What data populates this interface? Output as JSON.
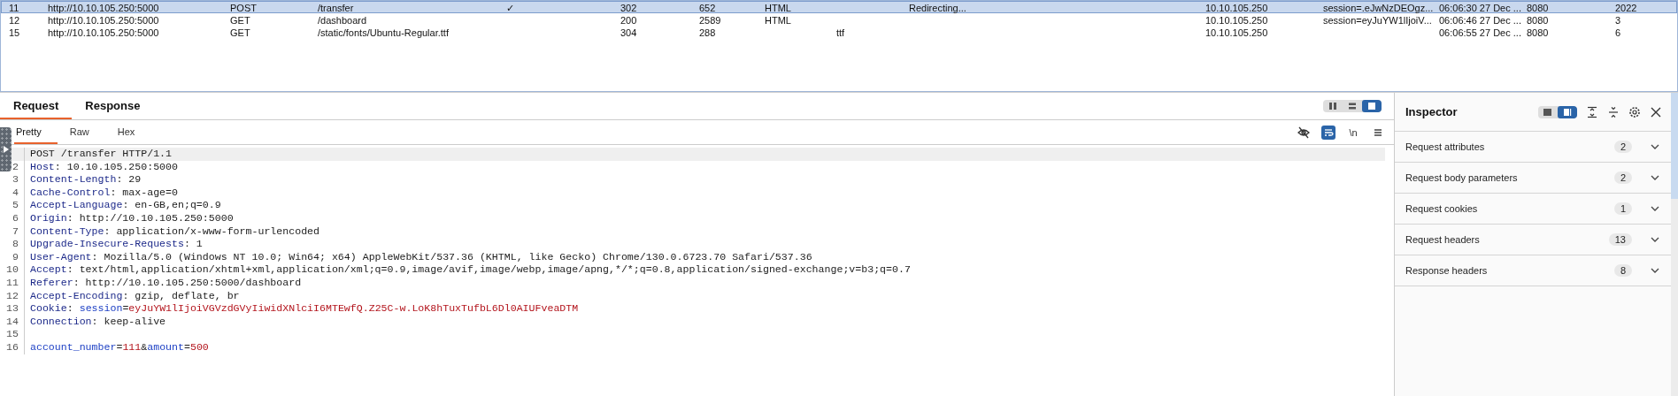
{
  "history": {
    "rows": [
      {
        "selected": true,
        "column_1": "11",
        "column_2": "http://10.10.105.250:5000",
        "column_3": "POST",
        "column_4": "/transfer",
        "column_5": "✓",
        "column_6": "302",
        "column_7": "652",
        "column_8": "HTML",
        "column_10": "Redirecting...",
        "column_11": "10.10.105.250",
        "column_12": "session=.eJwNzDEOgz...",
        "column_13": "06:06:30 27 Dec ...",
        "column_14": "8080",
        "column_15": "2022"
      },
      {
        "selected": false,
        "column_1": "12",
        "column_2": "http://10.10.105.250:5000",
        "column_3": "GET",
        "column_4": "/dashboard",
        "column_6": "200",
        "column_7": "2589",
        "column_8": "HTML",
        "column_11": "10.10.105.250",
        "column_12": "session=eyJuYW1lIjoiV...",
        "column_13": "06:06:46 27 Dec ...",
        "column_14": "8080",
        "column_15": "3"
      },
      {
        "selected": false,
        "column_1": "15",
        "column_2": "http://10.10.105.250:5000",
        "column_3": "GET",
        "column_4": "/static/fonts/Ubuntu-Regular.ttf",
        "column_6": "304",
        "column_7": "288",
        "column_9": "ttf",
        "column_11": "10.10.105.250",
        "column_13": "06:06:55 27 Dec ...",
        "column_14": "8080",
        "column_15": "6"
      }
    ]
  },
  "message_tabs": [
    {
      "label": "Request",
      "selected": true
    },
    {
      "label": "Response",
      "selected": false
    }
  ],
  "layout_buttons": [
    {
      "kind": "columns",
      "selected": false
    },
    {
      "kind": "rows",
      "selected": false
    },
    {
      "kind": "single",
      "selected": true
    }
  ],
  "view_tabs": [
    {
      "label": "Pretty",
      "selected": true
    },
    {
      "label": "Raw",
      "selected": false
    },
    {
      "label": "Hex",
      "selected": false
    }
  ],
  "editor_tools": [
    {
      "kind": "hide",
      "on": false
    },
    {
      "kind": "wrap",
      "on": true
    },
    {
      "kind": "newline",
      "text": "\\n",
      "on": false
    },
    {
      "kind": "menu",
      "on": false
    }
  ],
  "editor": {
    "lines": [
      {
        "highlighted": true,
        "segments": [
          {
            "kind": "plain",
            "text": "POST /transfer HTTP/1.1"
          }
        ]
      },
      {
        "number": "2",
        "highlighted": false,
        "segments": [
          {
            "kind": "key",
            "text": "Host"
          },
          {
            "kind": "plain",
            "text": ": 10.10.105.250:5000"
          }
        ]
      },
      {
        "number": "3",
        "highlighted": false,
        "segments": [
          {
            "kind": "key",
            "text": "Content-Length"
          },
          {
            "kind": "plain",
            "text": ": 29"
          }
        ]
      },
      {
        "number": "4",
        "highlighted": false,
        "segments": [
          {
            "kind": "key",
            "text": "Cache-Control"
          },
          {
            "kind": "plain",
            "text": ": max-age=0"
          }
        ]
      },
      {
        "number": "5",
        "highlighted": false,
        "segments": [
          {
            "kind": "key",
            "text": "Accept-Language"
          },
          {
            "kind": "plain",
            "text": ": en-GB,en;q=0.9"
          }
        ]
      },
      {
        "number": "6",
        "highlighted": false,
        "segments": [
          {
            "kind": "key",
            "text": "Origin"
          },
          {
            "kind": "plain",
            "text": ": http://10.10.105.250:5000"
          }
        ]
      },
      {
        "number": "7",
        "highlighted": false,
        "segments": [
          {
            "kind": "key",
            "text": "Content-Type"
          },
          {
            "kind": "plain",
            "text": ": application/x-www-form-urlencoded"
          }
        ]
      },
      {
        "number": "8",
        "highlighted": false,
        "segments": [
          {
            "kind": "key",
            "text": "Upgrade-Insecure-Requests"
          },
          {
            "kind": "plain",
            "text": ": 1"
          }
        ]
      },
      {
        "number": "9",
        "highlighted": false,
        "segments": [
          {
            "kind": "key",
            "text": "User-Agent"
          },
          {
            "kind": "plain",
            "text": ": Mozilla/5.0 (Windows NT 10.0; Win64; x64) AppleWebKit/537.36 (KHTML, like Gecko) Chrome/130.0.6723.70 Safari/537.36"
          }
        ]
      },
      {
        "number": "10",
        "highlighted": false,
        "segments": [
          {
            "kind": "key",
            "text": "Accept"
          },
          {
            "kind": "plain",
            "text": ": text/html,application/xhtml+xml,application/xml;q=0.9,image/avif,image/webp,image/apng,*/*;q=0.8,application/signed-exchange;v=b3;q=0.7"
          }
        ]
      },
      {
        "number": "11",
        "highlighted": false,
        "segments": [
          {
            "kind": "key",
            "text": "Referer"
          },
          {
            "kind": "plain",
            "text": ": http://10.10.105.250:5000/dashboard"
          }
        ]
      },
      {
        "number": "12",
        "highlighted": false,
        "segments": [
          {
            "kind": "key",
            "text": "Accept-Encoding"
          },
          {
            "kind": "plain",
            "text": ": gzip, deflate, br"
          }
        ]
      },
      {
        "number": "13",
        "highlighted": false,
        "segments": [
          {
            "kind": "key",
            "text": "Cookie"
          },
          {
            "kind": "plain",
            "text": ": "
          },
          {
            "kind": "param",
            "text": "session"
          },
          {
            "kind": "plain",
            "text": "="
          },
          {
            "kind": "value",
            "text": "eyJuYW1lIjoiVGVzdGVyIiwidXNlciI6MTEwfQ.Z25C-w.LoK8hTuxTufbL6Dl0AIUFveaDTM"
          }
        ]
      },
      {
        "number": "14",
        "highlighted": false,
        "segments": [
          {
            "kind": "key",
            "text": "Connection"
          },
          {
            "kind": "plain",
            "text": ": keep-alive"
          }
        ]
      },
      {
        "number": "15",
        "highlighted": false
      },
      {
        "number": "16",
        "highlighted": false,
        "segments": [
          {
            "kind": "param",
            "text": "account_number"
          },
          {
            "kind": "plain",
            "text": "="
          },
          {
            "kind": "value",
            "text": "111"
          },
          {
            "kind": "plain",
            "text": "&"
          },
          {
            "kind": "param",
            "text": "amount"
          },
          {
            "kind": "plain",
            "text": "="
          },
          {
            "kind": "value",
            "text": "500"
          }
        ]
      }
    ]
  },
  "inspector": {
    "title": "Inspector",
    "view_buttons": [
      {
        "kind": "wide",
        "selected": false
      },
      {
        "kind": "side",
        "selected": true
      }
    ],
    "sections": [
      {
        "label": "Request attributes",
        "count": "2",
        "expanded": false
      },
      {
        "label": "Request body parameters",
        "count": "2",
        "expanded": false
      },
      {
        "label": "Request cookies",
        "count": "1",
        "expanded": false
      },
      {
        "label": "Request headers",
        "count": "13",
        "expanded": false
      },
      {
        "label": "Response headers",
        "count": "8",
        "expanded": false
      }
    ]
  }
}
